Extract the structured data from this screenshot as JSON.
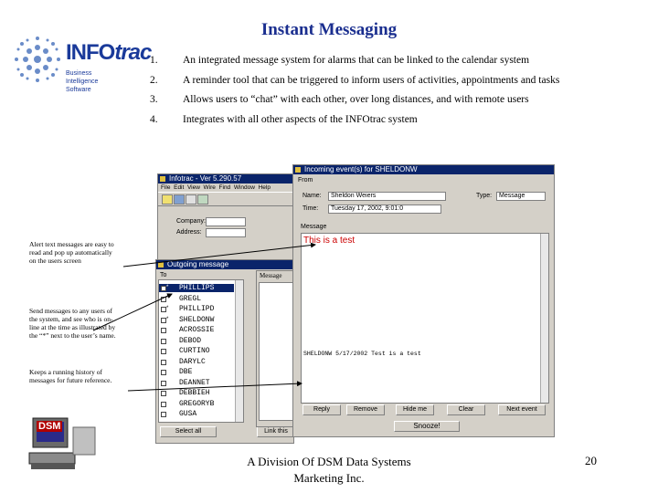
{
  "slide": {
    "title": "Instant Messaging",
    "logo_word_a": "INFO",
    "logo_word_b": "trac",
    "logo_sub": [
      "Business",
      "Intelligence",
      "Software"
    ],
    "points": [
      {
        "num": "1.",
        "text": "An integrated message system for alarms that can be linked to the calendar system"
      },
      {
        "num": "2.",
        "text": "A reminder tool that can be triggered to inform users of activities, appointments and tasks"
      },
      {
        "num": "3.",
        "text": "Allows users to “chat” with each other, over long distances, and with remote users"
      },
      {
        "num": "4.",
        "text": "Integrates with all other aspects of the INFOtrac system"
      }
    ],
    "annotations": {
      "alert": "Alert text messages are easy to read and pop up automatically on the users screen",
      "send": "Send messages to any users of the system, and see who is on-line at the time as illustrated by the “*” next to the user’s name.",
      "history": "Keeps a running history of messages for future reference."
    },
    "footer_line1": "A Division Of DSM Data Systems",
    "footer_line2": "Marketing Inc.",
    "page_number": "20",
    "dsm_logo_text": "DSM"
  },
  "main_window": {
    "title": "Infotrac - Ver 5.290.57",
    "menu": [
      "File",
      "Edit",
      "View",
      "Wire",
      "Find",
      "Window",
      "Help"
    ],
    "company_label": "Company:",
    "address_label": "Address:"
  },
  "incoming_window": {
    "title": "Incoming event(s) for SHELDONW",
    "from_label": "From",
    "name_label": "Name:",
    "name_value": "Sheldon Weiers",
    "type_label": "Type:",
    "type_value": "Message",
    "time_label": "Time:",
    "time_value": "Tuesday 17, 2002, 9:01:0",
    "message_label": "Message",
    "message_text": "This is a test",
    "history_line": "SHELDONW  5/17/2002      Test is a test",
    "buttons": [
      "Reply",
      "Remove",
      "Hide me",
      "Clear",
      "Next event"
    ],
    "snooze_label": "Snooze!"
  },
  "outgoing_window": {
    "title": "Outgoing message",
    "to_label": "To",
    "message_label": "Message",
    "users": [
      {
        "name": "PHILLIPS",
        "online": "*",
        "selected": true
      },
      {
        "name": "GREGL",
        "online": "*",
        "selected": false
      },
      {
        "name": "PHILLIPD",
        "online": "*",
        "selected": false
      },
      {
        "name": "SHELDONW",
        "online": "*",
        "selected": false
      },
      {
        "name": "ACROSSIE",
        "online": "",
        "selected": false
      },
      {
        "name": "DEBOD",
        "online": "",
        "selected": false
      },
      {
        "name": "CURTINO",
        "online": "",
        "selected": false
      },
      {
        "name": "DARYLC",
        "online": "",
        "selected": false
      },
      {
        "name": "DBE",
        "online": "",
        "selected": false
      },
      {
        "name": "DEANNET",
        "online": "",
        "selected": false
      },
      {
        "name": "DEBBIEH",
        "online": "",
        "selected": false
      },
      {
        "name": "GREGORYB",
        "online": "",
        "selected": false
      },
      {
        "name": "GUSA",
        "online": "",
        "selected": false
      }
    ],
    "select_button": "Select all",
    "link_button": "Link this"
  },
  "colors": {
    "title": "#1a2e8f",
    "titlebar": "#0a246a",
    "window": "#d4d0c8",
    "message_text": "#cc0000"
  }
}
